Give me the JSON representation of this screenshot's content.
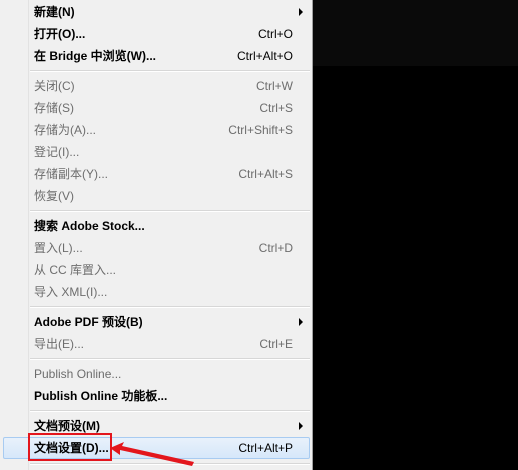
{
  "menu": {
    "items": [
      {
        "label": "新建(N)",
        "shortcut": "",
        "submenu": true,
        "disabled": false,
        "bold": true
      },
      {
        "label": "打开(O)...",
        "shortcut": "Ctrl+O",
        "submenu": false,
        "disabled": false,
        "bold": true
      },
      {
        "label": "在 Bridge 中浏览(W)...",
        "shortcut": "Ctrl+Alt+O",
        "submenu": false,
        "disabled": false,
        "bold": true
      },
      {
        "label": "关闭(C)",
        "shortcut": "Ctrl+W",
        "submenu": false,
        "disabled": true,
        "bold": false
      },
      {
        "label": "存储(S)",
        "shortcut": "Ctrl+S",
        "submenu": false,
        "disabled": true,
        "bold": false
      },
      {
        "label": "存储为(A)...",
        "shortcut": "Ctrl+Shift+S",
        "submenu": false,
        "disabled": true,
        "bold": false
      },
      {
        "label": "登记(I)...",
        "shortcut": "",
        "submenu": false,
        "disabled": true,
        "bold": false
      },
      {
        "label": "存储副本(Y)...",
        "shortcut": "Ctrl+Alt+S",
        "submenu": false,
        "disabled": true,
        "bold": false
      },
      {
        "label": "恢复(V)",
        "shortcut": "",
        "submenu": false,
        "disabled": true,
        "bold": false
      },
      {
        "label": "搜索 Adobe Stock...",
        "shortcut": "",
        "submenu": false,
        "disabled": false,
        "bold": true
      },
      {
        "label": "置入(L)...",
        "shortcut": "Ctrl+D",
        "submenu": false,
        "disabled": true,
        "bold": false
      },
      {
        "label": "从 CC 库置入...",
        "shortcut": "",
        "submenu": false,
        "disabled": true,
        "bold": false
      },
      {
        "label": "导入 XML(I)...",
        "shortcut": "",
        "submenu": false,
        "disabled": true,
        "bold": false
      },
      {
        "label": "Adobe PDF 预设(B)",
        "shortcut": "",
        "submenu": true,
        "disabled": false,
        "bold": true
      },
      {
        "label": "导出(E)...",
        "shortcut": "Ctrl+E",
        "submenu": false,
        "disabled": true,
        "bold": false
      },
      {
        "label": "Publish Online...",
        "shortcut": "",
        "submenu": false,
        "disabled": true,
        "bold": false
      },
      {
        "label": "Publish Online 功能板...",
        "shortcut": "",
        "submenu": false,
        "disabled": false,
        "bold": true
      },
      {
        "label": "文档预设(M)",
        "shortcut": "",
        "submenu": true,
        "disabled": false,
        "bold": true
      },
      {
        "label": "文档设置(D)...",
        "shortcut": "Ctrl+Alt+P",
        "submenu": false,
        "disabled": false,
        "bold": true,
        "highlighted": true
      }
    ]
  },
  "colors": {
    "menu_bg": "#f0f0f0",
    "disabled_text": "#6d6d6d",
    "highlight_border": "#a8cbf1",
    "annotation_red": "#e3161d"
  }
}
